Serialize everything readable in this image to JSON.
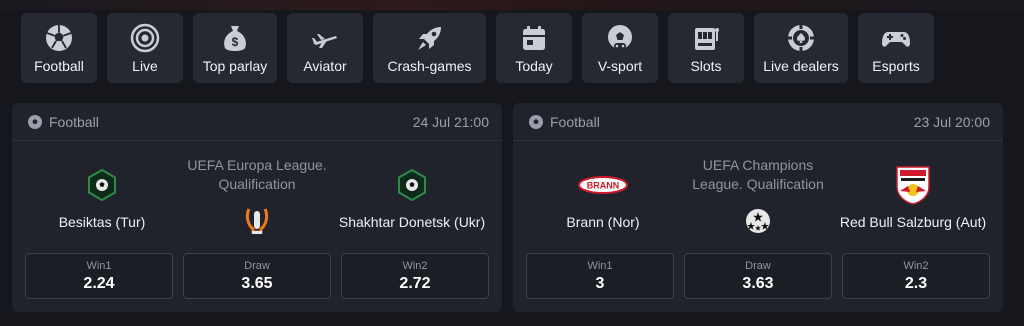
{
  "categories": [
    {
      "label": "Football",
      "icon": "football-icon"
    },
    {
      "label": "Live",
      "icon": "live-target-icon"
    },
    {
      "label": "Top parlay",
      "icon": "money-bag-icon"
    },
    {
      "label": "Aviator",
      "icon": "airplane-icon"
    },
    {
      "label": "Crash-games",
      "icon": "rocket-icon"
    },
    {
      "label": "Today",
      "icon": "calendar-icon"
    },
    {
      "label": "V-sport",
      "icon": "virtual-football-icon"
    },
    {
      "label": "Slots",
      "icon": "slot-machine-icon"
    },
    {
      "label": "Live dealers",
      "icon": "casino-chip-icon"
    },
    {
      "label": "Esports",
      "icon": "gamepad-icon"
    }
  ],
  "events": [
    {
      "sport": "Football",
      "datetime": "24 Jul 21:00",
      "league": "UEFA Europa League. Qualification",
      "home": "Besiktas (Tur)",
      "away": "Shakhtar Donetsk (Ukr)",
      "odds": [
        {
          "label": "Win1",
          "value": "2.24"
        },
        {
          "label": "Draw",
          "value": "3.65"
        },
        {
          "label": "Win2",
          "value": "2.72"
        }
      ]
    },
    {
      "sport": "Football",
      "datetime": "23 Jul 20:00",
      "league": "UEFA Champions League. Qualification",
      "home": "Brann (Nor)",
      "away": "Red Bull Salzburg (Aut)",
      "brann_logo_text": "BRANN",
      "odds": [
        {
          "label": "Win1",
          "value": "3"
        },
        {
          "label": "Draw",
          "value": "3.63"
        },
        {
          "label": "Win2",
          "value": "2.3"
        }
      ]
    }
  ],
  "colors": {
    "background": "#15171d",
    "tile": "#262932",
    "card": "#20232b",
    "accent_green": "#2f8a4a",
    "brann_red": "#d0192a",
    "europa_orange": "#f07a1a"
  }
}
